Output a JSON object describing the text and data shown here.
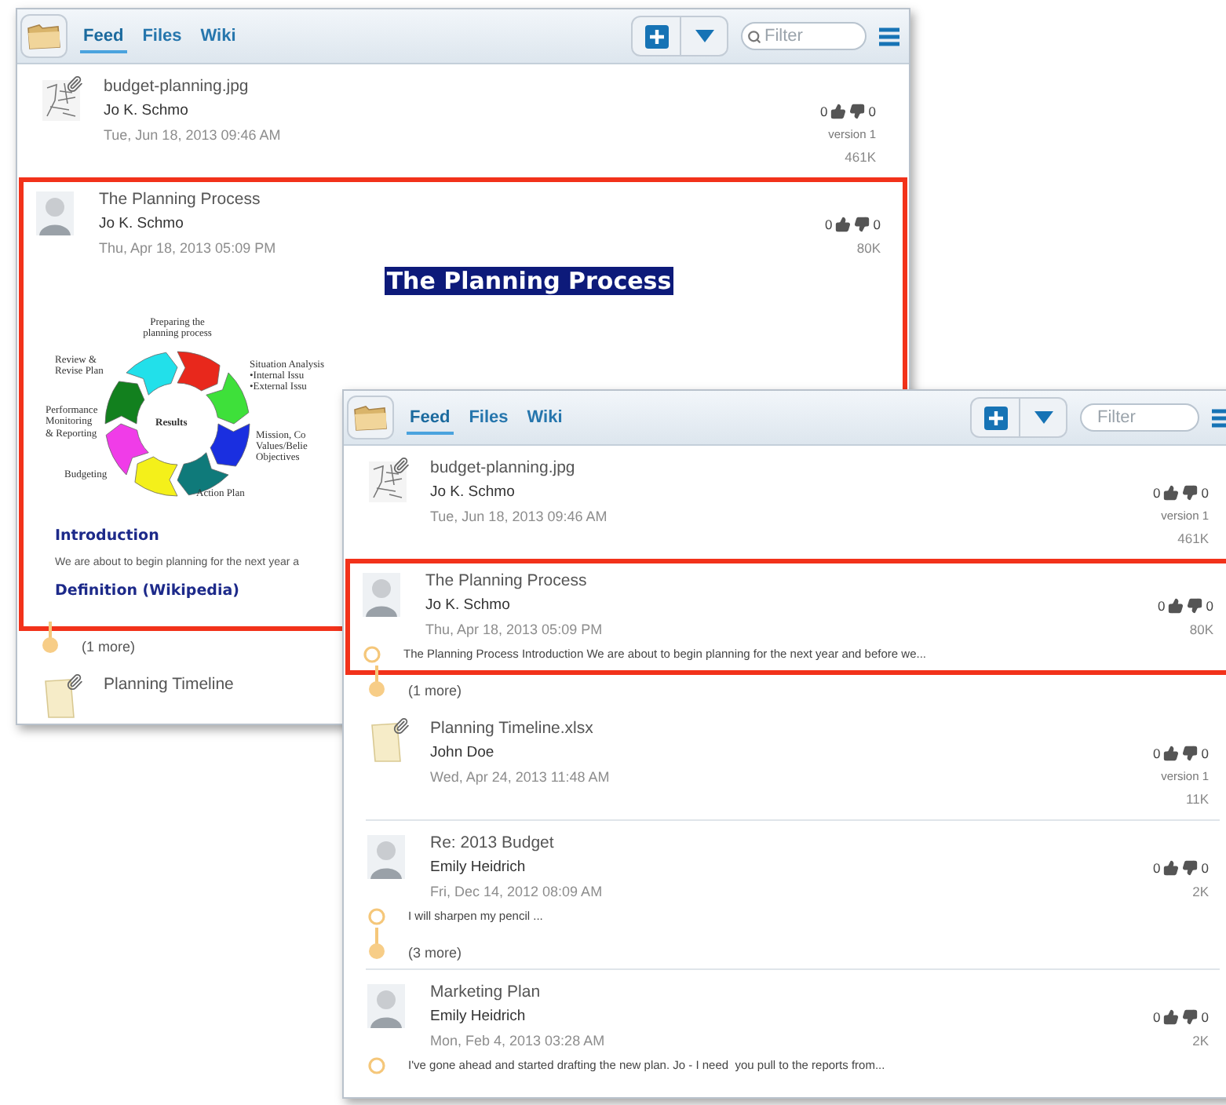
{
  "windows": [
    {
      "tabs": [
        {
          "label": "Feed",
          "selected": true
        },
        {
          "label": "Files",
          "selected": false
        },
        {
          "label": "Wiki",
          "selected": false
        }
      ],
      "filter": {
        "placeholder": "Filter",
        "icon": true
      },
      "items": [
        {
          "kind": "image",
          "attachment": true,
          "highlighted": false,
          "title": "budget-planning.jpg",
          "author": "Jo K. Schmo",
          "date": "Tue, Jun 18, 2013 09:46 AM",
          "likes": "0",
          "dislikes": "0",
          "version": "version 1",
          "size": "461K"
        },
        {
          "kind": "avatar",
          "attachment": false,
          "highlighted": true,
          "title": "The Planning Process",
          "author": "Jo K. Schmo",
          "date": "Thu, Apr 18, 2013 05:09 PM",
          "likes": "0",
          "dislikes": "0",
          "size": "80K",
          "preview": {
            "heading": "The Planning Process",
            "center": "Results",
            "labels": [
              "Preparing the planning process",
              "Review & Revise Plan",
              "Situation Analysis",
              "•Internal Issu",
              "•External Issu",
              "Performance Monitoring & Reporting",
              "Mission, Co",
              "Values/Belie",
              "Objectives",
              "Budgeting",
              "Action Plan"
            ],
            "subheading": "Introduction",
            "paragraph": "We are about to begin planning for the next year a",
            "link": "Definition (Wikipedia)"
          },
          "more": "(1 more)"
        },
        {
          "kind": "document",
          "attachment": true,
          "highlighted": false,
          "title": "Planning Timeline"
        }
      ]
    },
    {
      "tabs": [
        {
          "label": "Feed",
          "selected": true
        },
        {
          "label": "Files",
          "selected": false
        },
        {
          "label": "Wiki",
          "selected": false
        }
      ],
      "filter": {
        "placeholder": "Filter",
        "icon": false
      },
      "items": [
        {
          "kind": "image",
          "attachment": true,
          "highlighted": false,
          "title": "budget-planning.jpg",
          "author": "Jo K. Schmo",
          "date": "Tue, Jun 18, 2013 09:46 AM",
          "likes": "0",
          "dislikes": "0",
          "version": "version 1",
          "size": "461K"
        },
        {
          "kind": "avatar",
          "attachment": false,
          "highlighted": true,
          "title": "The Planning Process",
          "author": "Jo K. Schmo",
          "date": "Thu, Apr 18, 2013 05:09 PM",
          "likes": "0",
          "dislikes": "0",
          "size": "80K",
          "snippet": "The Planning Process Introduction We are about to begin planning for the next year and before we...",
          "more": "(1 more)"
        },
        {
          "kind": "document",
          "attachment": true,
          "highlighted": false,
          "title": "Planning Timeline.xlsx",
          "author": "John Doe",
          "date": "Wed, Apr 24, 2013 11:48 AM",
          "likes": "0",
          "dislikes": "0",
          "version": "version 1",
          "size": "11K"
        },
        {
          "kind": "avatar",
          "attachment": false,
          "highlighted": false,
          "title": "Re: 2013 Budget",
          "author": "Emily Heidrich",
          "date": "Fri, Dec 14, 2012 08:09 AM",
          "likes": "0",
          "dislikes": "0",
          "size": "2K",
          "snippet": "I will sharpen my pencil ...",
          "more": "(3 more)"
        },
        {
          "kind": "avatar",
          "attachment": false,
          "highlighted": false,
          "title": "Marketing Plan",
          "author": "Emily Heidrich",
          "date": "Mon, Feb 4, 2013 03:28 AM",
          "likes": "0",
          "dislikes": "0",
          "size": "2K",
          "snippet": "I've gone ahead and started drafting the new plan. Jo - I need  you pull to the reports from..."
        }
      ]
    }
  ]
}
